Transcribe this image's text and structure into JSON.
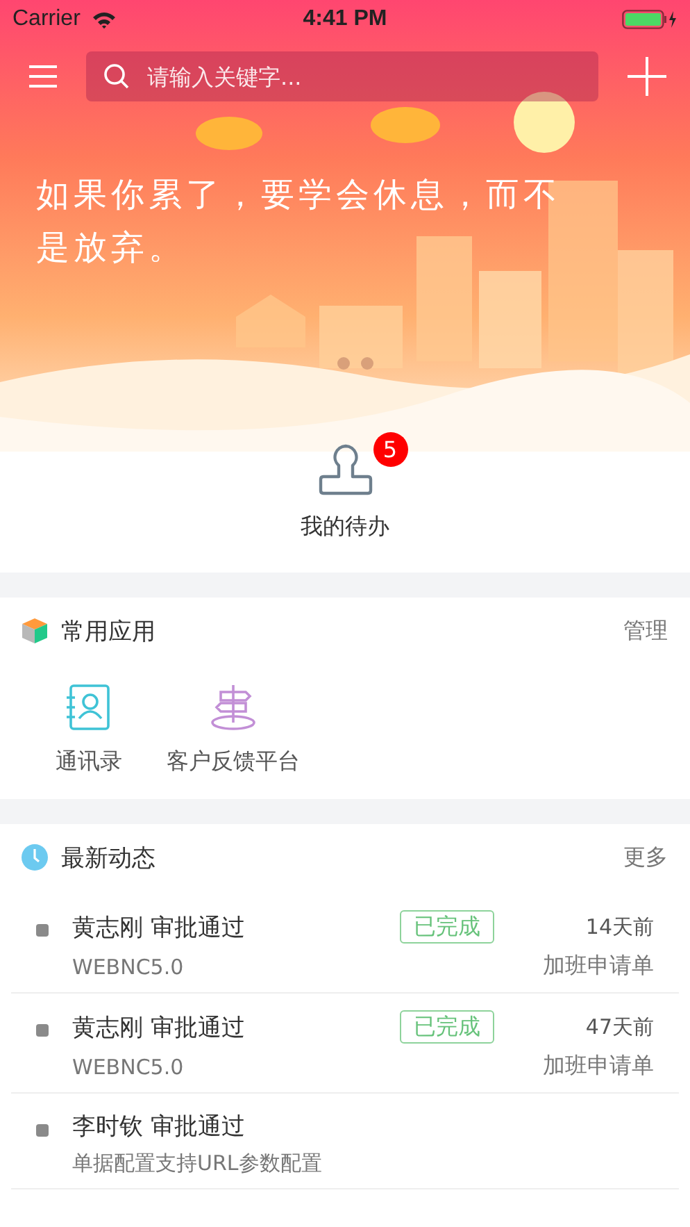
{
  "status_bar": {
    "carrier": "Carrier",
    "time": "4:41 PM"
  },
  "search": {
    "placeholder": "请输入关键字..."
  },
  "banner": {
    "quote": "如果你累了，要学会休息，而不是放弃。"
  },
  "todo": {
    "label": "我的待办",
    "badge": "5"
  },
  "apps": {
    "title": "常用应用",
    "action": "管理",
    "items": [
      {
        "label": "通讯录",
        "kind": "contacts"
      },
      {
        "label": "客户反馈平台",
        "kind": "signpost"
      }
    ]
  },
  "news": {
    "title": "最新动态",
    "action": "更多",
    "items": [
      {
        "title": "黄志刚 审批通过",
        "subtitle": "WEBNC5.0",
        "status": "已完成",
        "time": "14天前",
        "type": "加班申请单"
      },
      {
        "title": "黄志刚 审批通过",
        "subtitle": "WEBNC5.0",
        "status": "已完成",
        "time": "47天前",
        "type": "加班申请单"
      },
      {
        "title": "李时钦 审批通过",
        "subtitle": "单据配置支持URL参数配置"
      }
    ]
  }
}
